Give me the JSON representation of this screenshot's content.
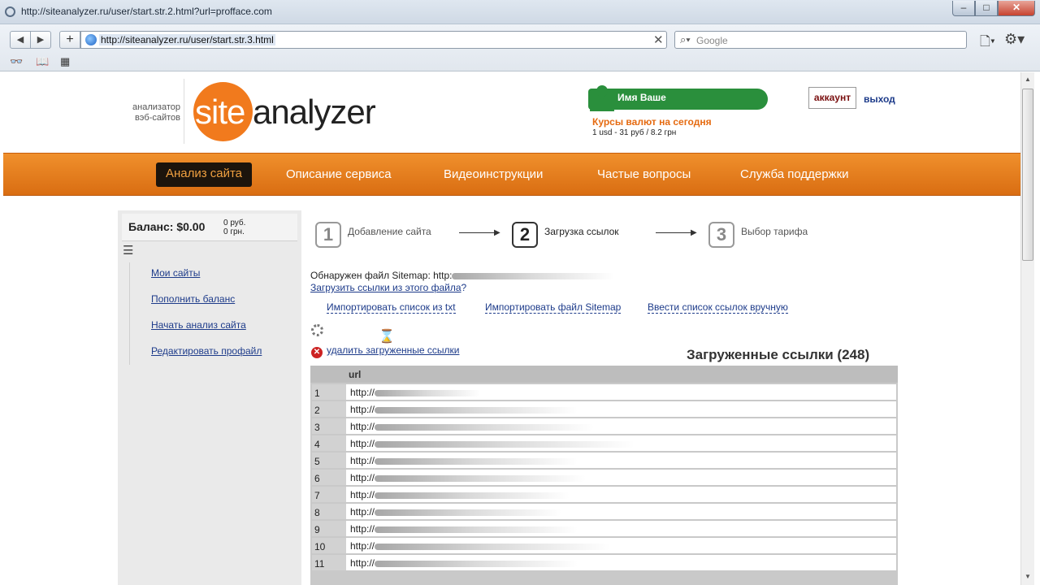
{
  "window": {
    "title": "http://siteanalyzer.ru/user/start.str.2.html?url=profface.com"
  },
  "browser": {
    "url": "http://siteanalyzer.ru/user/start.str.3.html",
    "search_placeholder": "Google",
    "icons": [
      "back-arrow-icon",
      "forward-arrow-icon",
      "plus-icon",
      "globe-icon",
      "close-icon",
      "search-icon",
      "page-icon",
      "gear-icon",
      "glasses-icon",
      "book-icon",
      "grid-icon"
    ]
  },
  "header": {
    "tagline_1": "анализатор",
    "tagline_2": "вэб-сайтов",
    "logo_site": "site",
    "logo_analyzer": "analyzer",
    "user_name": "Имя Ваше",
    "rates_title": "Курсы валют на сегодня",
    "rates_value": "1 usd - 31 руб / 8.2 грн",
    "account": "аккаунт",
    "logout": "выход"
  },
  "nav": {
    "items": [
      "Анализ сайта",
      "Описание сервиса",
      "Видеоинструкции",
      "Частые вопросы",
      "Служба поддержки"
    ]
  },
  "sidebar": {
    "balance": "Баланс: $0.00",
    "balance_rub": "0 руб.",
    "balance_grn": "0 грн.",
    "links": [
      "Мои сайты",
      "Пополнить баланс",
      "Начать анализ сайта",
      "Редактировать профайл"
    ]
  },
  "steps": [
    {
      "num": "1",
      "label": "Добавление сайта"
    },
    {
      "num": "2",
      "label": "Загрузка ссылок"
    },
    {
      "num": "3",
      "label": "Выбор тарифа"
    }
  ],
  "main": {
    "sitemap_found": "Обнаружен файл Sitemap: http:",
    "load_sitemap_link": "Загрузить ссылки из этого файла",
    "load_sitemap_q": "?",
    "import_txt": "Импортировать список из txt",
    "import_sitemap": "Импортировать файл Sitemap",
    "manual_entry": "Ввести список ссылок вручную",
    "delete_link": "удалить загруженные ссылки",
    "loaded_title": "Загруженные ссылки (248)"
  },
  "table": {
    "header": "url",
    "rows": [
      {
        "num": "1",
        "url": "http://"
      },
      {
        "num": "2",
        "url": "http://"
      },
      {
        "num": "3",
        "url": "http://"
      },
      {
        "num": "4",
        "url": "http://"
      },
      {
        "num": "5",
        "url": "http://"
      },
      {
        "num": "6",
        "url": "http://"
      },
      {
        "num": "7",
        "url": "http://"
      },
      {
        "num": "8",
        "url": "http://"
      },
      {
        "num": "9",
        "url": "http://"
      },
      {
        "num": "10",
        "url": "http://"
      },
      {
        "num": "11",
        "url": "http://"
      }
    ]
  }
}
